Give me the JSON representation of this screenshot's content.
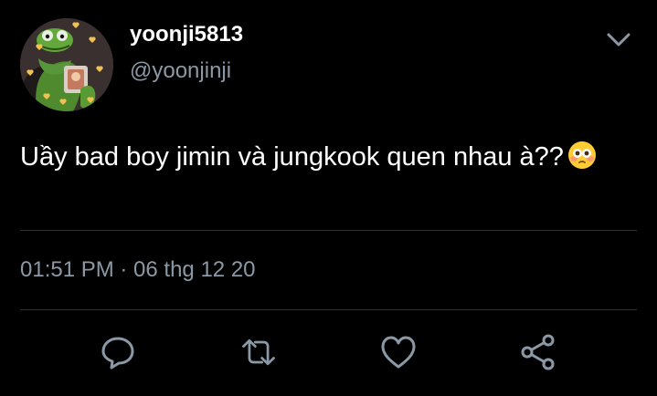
{
  "user": {
    "display_name": "yoonji5813",
    "handle": "@yoonjinji",
    "avatar_icon": "kermit-frog-avatar"
  },
  "tweet": {
    "text": "Uầy bad boy jimin và jungkook quen nhau à??",
    "emoji": "flushed-face-emoji",
    "timestamp": "01:51 PM · 06 thg 12 20"
  },
  "actions": [
    "reply-icon",
    "retweet-icon",
    "like-icon",
    "share-icon"
  ],
  "colors": {
    "background": "#000000",
    "primary_text": "#ffffff",
    "secondary_text": "#8b98a5",
    "divider": "#2f3336",
    "icon": "#8b98a5"
  }
}
